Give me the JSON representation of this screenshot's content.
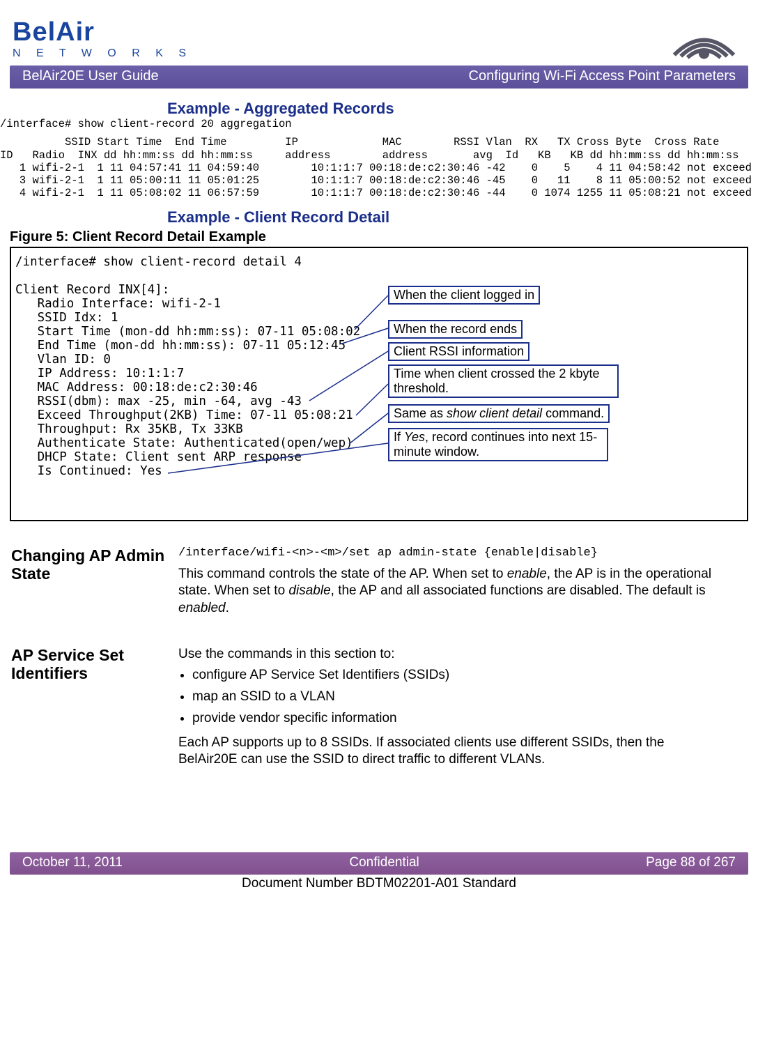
{
  "logo": {
    "name": "BelAir",
    "sub": "N E T W O R K S"
  },
  "header": {
    "left": "BelAir20E User Guide",
    "right": "Configuring Wi-Fi Access Point Parameters"
  },
  "ex1_title": "Example - Aggregated Records",
  "ex1_cmd": "/interface# show client-record 20 aggregation",
  "table": "          SSID Start Time  End Time         IP             MAC        RSSI Vlan  RX   TX Cross Byte  Cross Rate\nID   Radio  INX dd hh:mm:ss dd hh:mm:ss     address        address       avg  Id   KB   KB dd hh:mm:ss dd hh:mm:ss\n   1 wifi-2-1  1 11 04:57:41 11 04:59:40        10:1:1:7 00:18:de:c2:30:46 -42    0    5    4 11 04:58:42 not exceed\n   3 wifi-2-1  1 11 05:00:11 11 05:01:25        10:1:1:7 00:18:de:c2:30:46 -45    0   11    8 11 05:00:52 not exceed\n   4 wifi-2-1  1 11 05:08:02 11 06:57:59        10:1:1:7 00:18:de:c2:30:46 -44    0 1074 1255 11 05:08:21 not exceed",
  "ex2_title": "Example - Client Record Detail",
  "fig_caption": "Figure 5: Client Record Detail Example",
  "detail": "/interface# show client-record detail 4\n\nClient Record INX[4]:\n   Radio Interface: wifi-2-1\n   SSID Idx: 1\n   Start Time (mon-dd hh:mm:ss): 07-11 05:08:02\n   End Time (mon-dd hh:mm:ss): 07-11 05:12:45\n   Vlan ID: 0\n   IP Address: 10:1:1:7\n   MAC Address: 00:18:de:c2:30:46\n   RSSI(dbm): max -25, min -64, avg -43\n   Exceed Throughput(2KB) Time: 07-11 05:08:21\n   Throughput: Rx 35KB, Tx 33KB\n   Authenticate State: Authenticated(open/wep)\n   DHCP State: Client sent ARP response\n   Is Continued: Yes",
  "callouts": {
    "c1": "When the client logged in",
    "c2": "When the record ends",
    "c3": "Client RSSI information",
    "c4": "Time when client crossed the 2 kbyte threshold.",
    "c5_a": "Same as ",
    "c5_b": "show client detail",
    "c5_c": " command.",
    "c6_a": "If ",
    "c6_b": "Yes",
    "c6_c": ", record continues into next 15-minute window."
  },
  "sec1_head": "Changing AP Admin State",
  "sec1_cmd": "/interface/wifi-<n>-<m>/set ap admin-state {enable|disable}",
  "sec1_body_a": "This command controls the state of the AP. When set to ",
  "sec1_body_b": "enable",
  "sec1_body_c": ", the AP is in the operational state. When set to ",
  "sec1_body_d": "disable",
  "sec1_body_e": ", the AP and all associated functions are disabled. The default is ",
  "sec1_body_f": "enabled",
  "sec1_body_g": ".",
  "sec2_head": "AP Service Set Identifiers",
  "sec2_intro": "Use the commands in this section to:",
  "sec2_b1": "configure AP Service Set Identifiers (SSIDs)",
  "sec2_b2": "map an SSID to a VLAN",
  "sec2_b3": "provide vendor specific information",
  "sec2_tail": "Each AP supports up to 8 SSIDs. If associated clients use different SSIDs, then the BelAir20E can use the SSID to direct traffic to different VLANs.",
  "footer": {
    "left": "October 11, 2011",
    "center": "Confidential",
    "right": "Page 88 of 267"
  },
  "docnum": "Document Number BDTM02201-A01 Standard"
}
